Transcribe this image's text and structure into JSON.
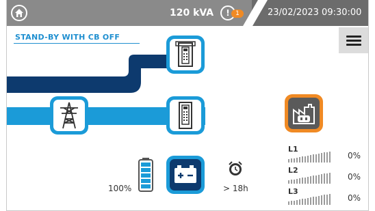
{
  "header": {
    "power": "120 kVA",
    "alarm_count": "1",
    "datetime": "23/02/2023 09:30:00"
  },
  "status": "STAND-BY WITH CB OFF",
  "battery": {
    "charge": "100%",
    "autonomy": "> 18h"
  },
  "phases": [
    {
      "label": "L1",
      "value": "0%"
    },
    {
      "label": "L2",
      "value": "0%"
    },
    {
      "label": "L3",
      "value": "0%"
    }
  ],
  "colors": {
    "accent": "#1b9bd8",
    "dark_flow": "#0d3a6e",
    "light_flow": "#1b9bd8",
    "load": "#f08a24",
    "header": "#8a8a8a"
  },
  "icons": [
    "home-icon",
    "alarm-icon",
    "menu-icon",
    "ups-bypass-icon",
    "grid-pylon-icon",
    "ups-main-icon",
    "battery-converter-icon",
    "load-icon",
    "timer-icon",
    "battery-level-icon"
  ]
}
